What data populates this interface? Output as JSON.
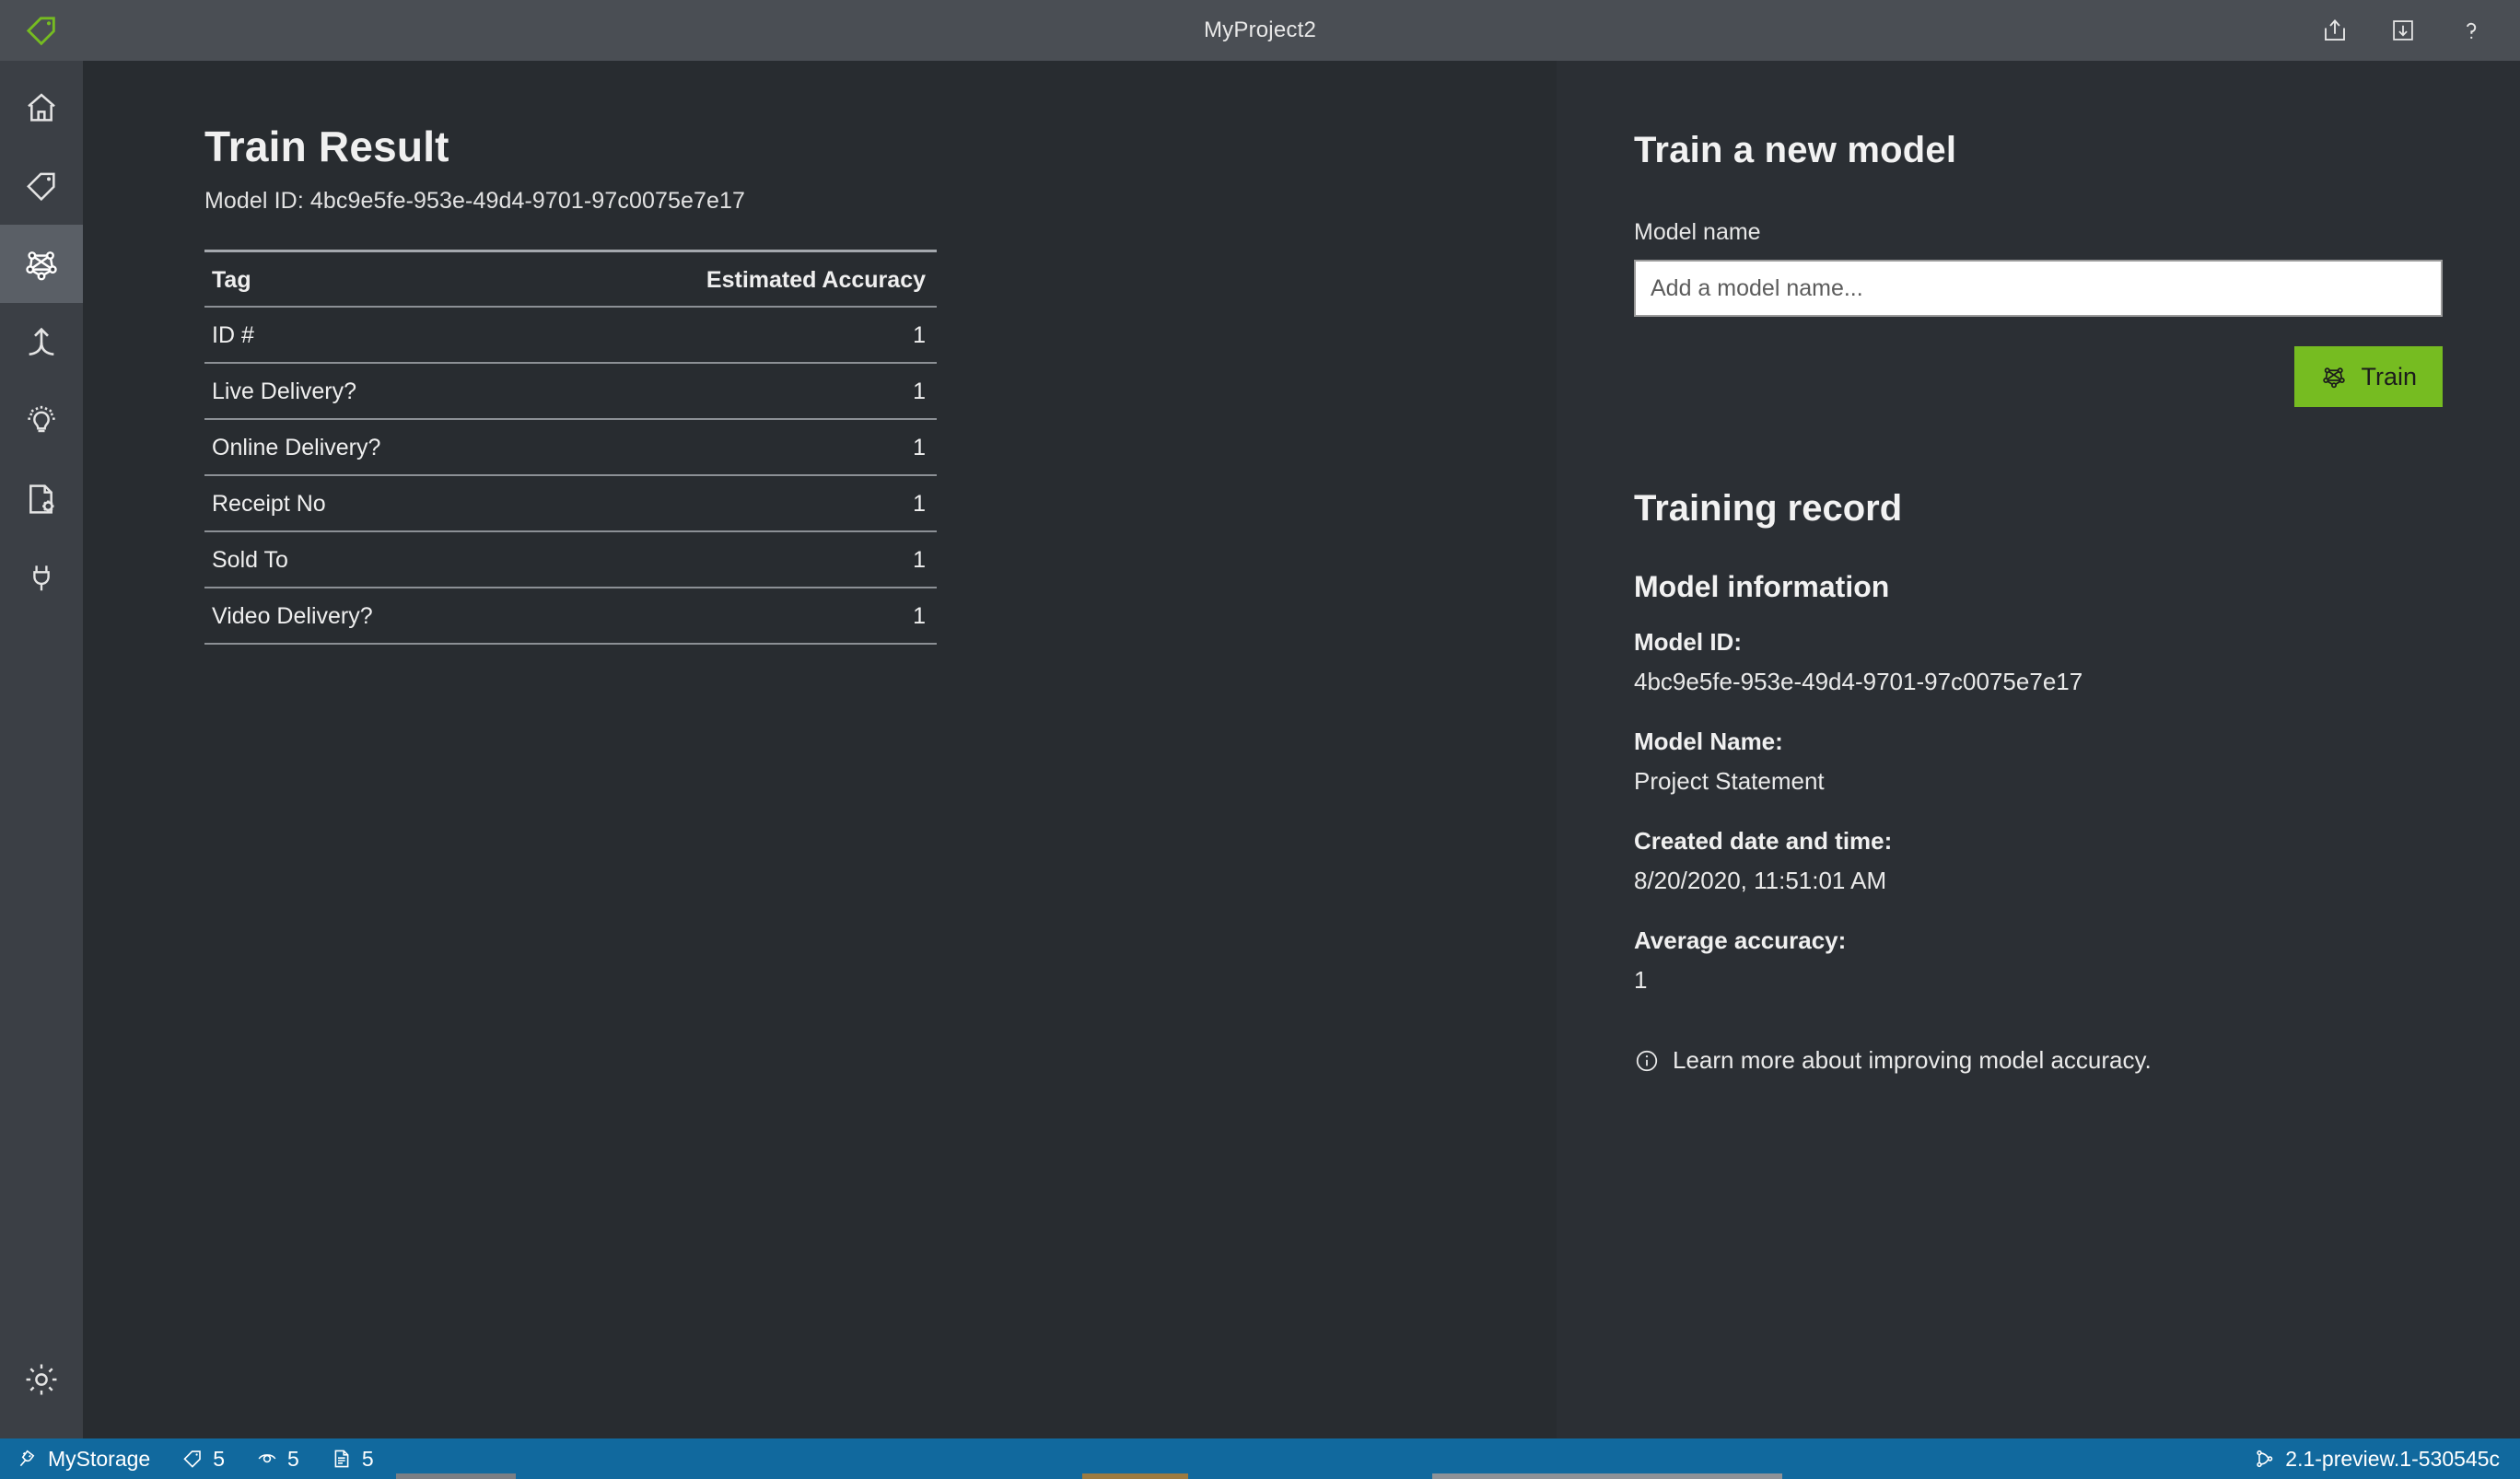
{
  "titlebar": {
    "logo_icon": "tag-logo-icon",
    "title": "MyProject2",
    "actions": [
      {
        "name": "share-icon",
        "label": "Share"
      },
      {
        "name": "feedback-icon",
        "label": "Feedback"
      },
      {
        "name": "help-icon",
        "label": "Help"
      }
    ]
  },
  "sidebar": {
    "items": [
      {
        "name": "home",
        "icon": "home-icon",
        "label": "Home",
        "selected": false
      },
      {
        "name": "tags",
        "icon": "tag-icon",
        "label": "Tags",
        "selected": false
      },
      {
        "name": "model-train",
        "icon": "model-network-icon",
        "label": "Train",
        "selected": true
      },
      {
        "name": "compose",
        "icon": "merge-arrow-icon",
        "label": "Compose",
        "selected": false
      },
      {
        "name": "predict",
        "icon": "lightbulb-icon",
        "label": "Predict",
        "selected": false
      },
      {
        "name": "document-settings",
        "icon": "document-gear-icon",
        "label": "Document Settings",
        "selected": false
      },
      {
        "name": "connections",
        "icon": "plug-icon",
        "label": "Connections",
        "selected": false
      }
    ],
    "bottom": {
      "name": "application-settings",
      "icon": "gear-icon",
      "label": "Settings"
    }
  },
  "main": {
    "page_title": "Train Result",
    "model_id_line": "Model ID: 4bc9e5fe-953e-49d4-9701-97c0075e7e17",
    "table": {
      "columns": [
        "Tag",
        "Estimated Accuracy"
      ],
      "rows": [
        {
          "tag": "ID #",
          "accuracy": "1"
        },
        {
          "tag": "Live Delivery?",
          "accuracy": "1"
        },
        {
          "tag": "Online Delivery?",
          "accuracy": "1"
        },
        {
          "tag": "Receipt No",
          "accuracy": "1"
        },
        {
          "tag": "Sold To",
          "accuracy": "1"
        },
        {
          "tag": "Video Delivery?",
          "accuracy": "1"
        }
      ]
    }
  },
  "right_panel": {
    "train_heading": "Train a new model",
    "model_name_label": "Model name",
    "model_name_placeholder": "Add a model name...",
    "model_name_value": "",
    "train_button_label": "Train",
    "train_button_icon": "model-network-icon",
    "training_record_heading": "Training record",
    "model_information_heading": "Model information",
    "fields": [
      {
        "label": "Model ID:",
        "value": "4bc9e5fe-953e-49d4-9701-97c0075e7e17"
      },
      {
        "label": "Model Name:",
        "value": "Project Statement"
      },
      {
        "label": "Created date and time:",
        "value": "8/20/2020, 11:51:01 AM"
      },
      {
        "label": "Average accuracy:",
        "value": "1"
      }
    ],
    "note_icon": "info-icon",
    "note_text": "Learn more about improving model accuracy."
  },
  "statusbar": {
    "connection_icon": "plug-icon",
    "connection_name": "MyStorage",
    "tag_icon": "tag-icon",
    "tag_count": "5",
    "eye_icon": "eye-icon",
    "eye_count": "5",
    "document_icon": "document-icon",
    "document_count": "5",
    "version_icon": "branch-icon",
    "version": "2.1-preview.1-530545c"
  },
  "colors": {
    "accent_green": "#76bc21",
    "status_blue": "#11699e",
    "titlebar": "#4a4e54",
    "sidebar": "#3b3f45",
    "main_bg": "#282c30",
    "panel_bg": "#2b2f34"
  }
}
